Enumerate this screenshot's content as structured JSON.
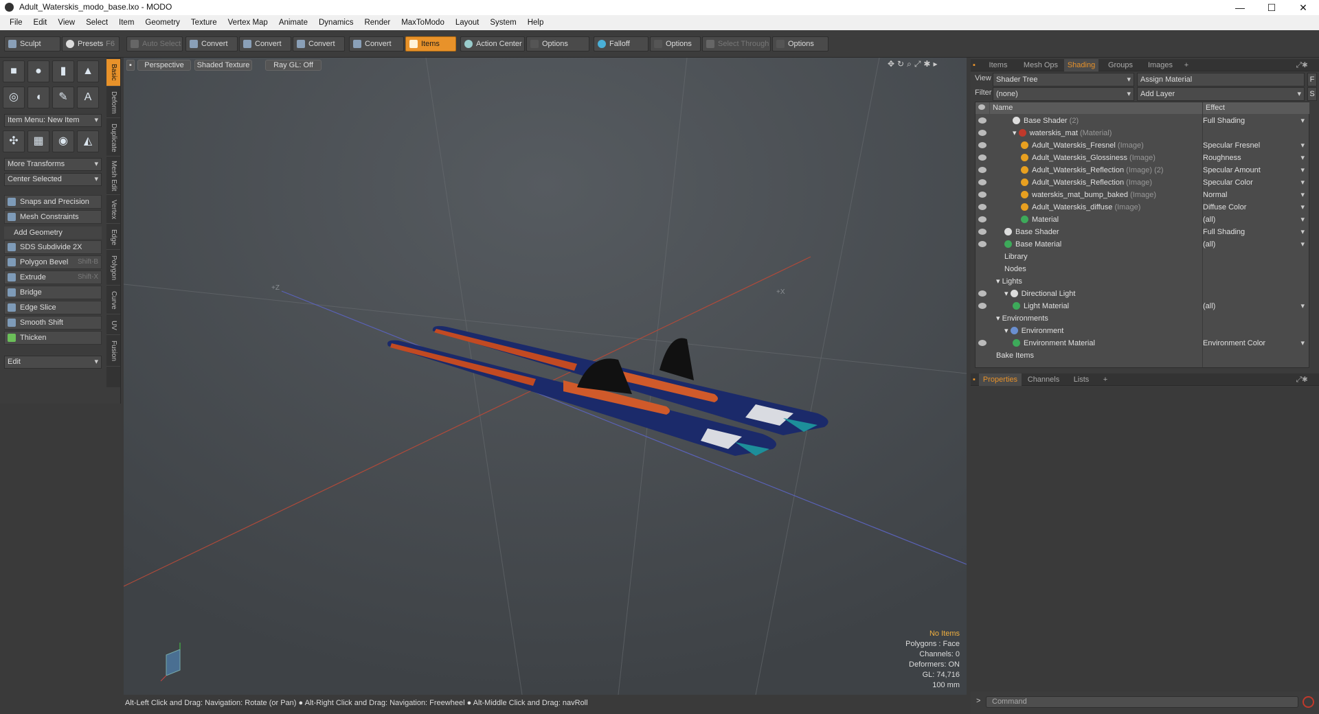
{
  "window": {
    "title": "Adult_Waterskis_modo_base.lxo - MODO",
    "min": "—",
    "max": "☐",
    "close": "✕"
  },
  "menu": [
    "File",
    "Edit",
    "View",
    "Select",
    "Item",
    "Geometry",
    "Texture",
    "Vertex Map",
    "Animate",
    "Dynamics",
    "Render",
    "MaxToModo",
    "Layout",
    "System",
    "Help"
  ],
  "toolbar": {
    "sculpt": "Sculpt",
    "presets": "Presets",
    "presets_key": "F6",
    "auto_select": "Auto Select",
    "convert": "Convert",
    "items": "Items",
    "action_center": "Action Center",
    "options": "Options",
    "falloff": "Falloff",
    "select_through": "Select Through"
  },
  "left": {
    "item_menu": "Item Menu: New Item",
    "more_transforms": "More Transforms",
    "center_selected": "Center Selected",
    "snaps": "Snaps and Precision",
    "mesh_constraints": "Mesh Constraints",
    "add_geometry": "Add Geometry",
    "tools": [
      {
        "label": "SDS Subdivide 2X",
        "key": ""
      },
      {
        "label": "Polygon Bevel",
        "key": "Shift-B"
      },
      {
        "label": "Extrude",
        "key": "Shift-X"
      },
      {
        "label": "Bridge",
        "key": ""
      },
      {
        "label": "Edge Slice",
        "key": ""
      },
      {
        "label": "Smooth Shift",
        "key": ""
      },
      {
        "label": "Thicken",
        "key": ""
      }
    ],
    "edit": "Edit"
  },
  "vtabs": [
    "Basic",
    "Deform",
    "Duplicate",
    "Mesh Edit",
    "Vertex",
    "Edge",
    "Polygon",
    "Curve",
    "UV",
    "Fusion"
  ],
  "viewport": {
    "perspective": "Perspective",
    "shaded": "Shaded Texture",
    "raygl": "Ray GL: Off",
    "axis_z": "+Z",
    "axis_x": "+X",
    "info": [
      "No Items",
      "Polygons : Face",
      "Channels: 0",
      "Deformers: ON",
      "GL: 74,716",
      "100 mm"
    ]
  },
  "status": "Alt-Left Click and Drag: Navigation: Rotate (or Pan) ● Alt-Right Click and Drag: Navigation: Freewheel ● Alt-Middle Click and Drag: navRoll",
  "right": {
    "tabs": [
      "Items",
      "Mesh Ops",
      "Shading",
      "Groups",
      "Images",
      "+"
    ],
    "view_label": "View",
    "view_value": "Shader Tree",
    "assign": "Assign Material",
    "filter_label": "Filter",
    "filter_value": "(none)",
    "add_layer": "Add Layer",
    "col_name": "Name",
    "col_effect": "Effect",
    "rows": [
      {
        "name": "Base Shader",
        "sub": "(2)",
        "effect": "Full Shading",
        "indent": 2,
        "ball": "#ddd",
        "eye": true
      },
      {
        "name": "waterskis_mat",
        "sub": "(Material)",
        "effect": "",
        "indent": 2,
        "ball": "#c0392b",
        "eye": true,
        "open": true
      },
      {
        "name": "Adult_Waterskis_Fresnel",
        "sub": "(Image)",
        "effect": "Specular Fresnel",
        "indent": 3,
        "ball": "#e8a020",
        "eye": true
      },
      {
        "name": "Adult_Waterskis_Glossiness",
        "sub": "(Image)",
        "effect": "Roughness",
        "indent": 3,
        "ball": "#e8a020",
        "eye": true
      },
      {
        "name": "Adult_Waterskis_Reflection",
        "sub": "(Image) (2)",
        "effect": "Specular Amount",
        "indent": 3,
        "ball": "#e8a020",
        "eye": true
      },
      {
        "name": "Adult_Waterskis_Reflection",
        "sub": "(Image)",
        "effect": "Specular Color",
        "indent": 3,
        "ball": "#e8a020",
        "eye": true
      },
      {
        "name": "waterskis_mat_bump_baked",
        "sub": "(Image)",
        "effect": "Normal",
        "indent": 3,
        "ball": "#e8a020",
        "eye": true
      },
      {
        "name": "Adult_Waterskis_diffuse",
        "sub": "(Image)",
        "effect": "Diffuse Color",
        "indent": 3,
        "ball": "#e8a020",
        "eye": true
      },
      {
        "name": "Material",
        "sub": "",
        "effect": "(all)",
        "indent": 3,
        "ball": "#3daa5a",
        "eye": true
      },
      {
        "name": "Base Shader",
        "sub": "",
        "effect": "Full Shading",
        "indent": 1,
        "ball": "#ddd",
        "eye": true
      },
      {
        "name": "Base Material",
        "sub": "",
        "effect": "(all)",
        "indent": 1,
        "ball": "#3daa5a",
        "eye": true
      },
      {
        "name": "Library",
        "sub": "",
        "effect": "",
        "indent": 1,
        "ball": "",
        "eye": false
      },
      {
        "name": "Nodes",
        "sub": "",
        "effect": "",
        "indent": 1,
        "ball": "",
        "eye": false
      },
      {
        "name": "Lights",
        "sub": "",
        "effect": "",
        "indent": 0,
        "ball": "",
        "eye": false,
        "open": true
      },
      {
        "name": "Directional Light",
        "sub": "",
        "effect": "",
        "indent": 1,
        "ball": "#ddd",
        "eye": true,
        "open": true
      },
      {
        "name": "Light Material",
        "sub": "",
        "effect": "(all)",
        "indent": 2,
        "ball": "#3daa5a",
        "eye": true
      },
      {
        "name": "Environments",
        "sub": "",
        "effect": "",
        "indent": 0,
        "ball": "",
        "eye": false,
        "open": true
      },
      {
        "name": "Environment",
        "sub": "",
        "effect": "",
        "indent": 1,
        "ball": "#6a8fd0",
        "eye": false,
        "open": true
      },
      {
        "name": "Environment Material",
        "sub": "",
        "effect": "Environment Color",
        "indent": 2,
        "ball": "#3daa5a",
        "eye": true
      },
      {
        "name": "Bake Items",
        "sub": "",
        "effect": "",
        "indent": 0,
        "ball": "",
        "eye": false
      }
    ],
    "prop_tabs": [
      "Properties",
      "Channels",
      "Lists",
      "+"
    ],
    "command": "Command"
  }
}
